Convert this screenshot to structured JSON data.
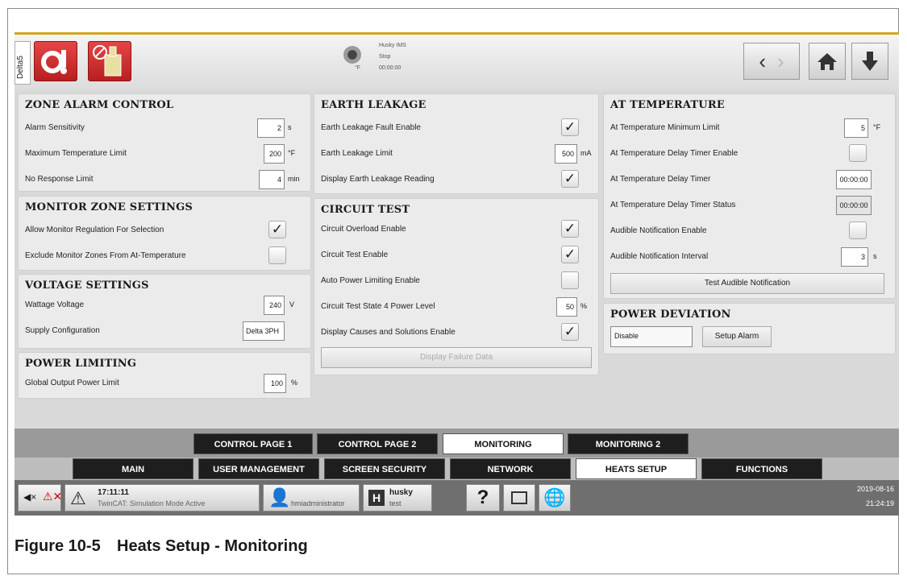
{
  "side_tag": "Delta5",
  "status": {
    "name": "Husky IMS",
    "state": "Stop",
    "time": "00:00:00",
    "unit": "°F"
  },
  "zone_alarm": {
    "title": "ZONE ALARM CONTROL",
    "rows": [
      {
        "label": "Alarm Sensitivity",
        "value": "2",
        "unit": "s"
      },
      {
        "label": "Maximum Temperature Limit",
        "value": "200",
        "unit": "°F"
      },
      {
        "label": "No Response Limit",
        "value": "4",
        "unit": "min"
      }
    ]
  },
  "monitor_zone": {
    "title": "MONITOR ZONE SETTINGS",
    "rows": [
      {
        "label": "Allow Monitor Regulation For Selection",
        "checked": true
      },
      {
        "label": "Exclude Monitor Zones From At-Temperature",
        "checked": false
      }
    ]
  },
  "voltage": {
    "title": "VOLTAGE SETTINGS",
    "wattage_label": "Wattage Voltage",
    "wattage_value": "240",
    "wattage_unit": "V",
    "supply_label": "Supply Configuration",
    "supply_value": "Delta 3PH"
  },
  "power_limiting": {
    "title": "POWER LIMITING",
    "label": "Global Output Power Limit",
    "value": "100",
    "unit": "%"
  },
  "earth_leakage": {
    "title": "EARTH LEAKAGE",
    "fault_label": "Earth Leakage Fault Enable",
    "fault_checked": true,
    "limit_label": "Earth Leakage Limit",
    "limit_value": "500",
    "limit_unit": "mA",
    "display_label": "Display Earth Leakage Reading",
    "display_checked": true
  },
  "circuit_test": {
    "title": "CIRCUIT TEST",
    "overload_label": "Circuit Overload Enable",
    "overload_checked": true,
    "enable_label": "Circuit Test Enable",
    "enable_checked": true,
    "auto_label": "Auto Power Limiting Enable",
    "auto_checked": false,
    "state4_label": "Circuit Test State 4 Power Level",
    "state4_value": "50",
    "state4_unit": "%",
    "causes_label": "Display Causes and Solutions Enable",
    "causes_checked": true,
    "failure_button": "Display Failure Data"
  },
  "at_temperature": {
    "title": "AT TEMPERATURE",
    "min_label": "At Temperature Minimum Limit",
    "min_value": "5",
    "min_unit": "°F",
    "delay_enable_label": "At Temperature Delay Timer Enable",
    "delay_enable_checked": false,
    "delay_label": "At Temperature Delay Timer",
    "delay_value": "00:00:00",
    "delay_status_label": "At Temperature Delay Timer Status",
    "delay_status_value": "00:00:00",
    "audible_label": "Audible Notification Enable",
    "audible_checked": false,
    "interval_label": "Audible Notification Interval",
    "interval_value": "3",
    "interval_unit": "s",
    "test_button": "Test Audible Notification"
  },
  "power_deviation": {
    "title": "POWER DEVIATION",
    "value": "Disable",
    "setup_button": "Setup Alarm"
  },
  "subtabs": [
    "CONTROL PAGE 1",
    "CONTROL PAGE 2",
    "MONITORING",
    "MONITORING 2"
  ],
  "maintabs": [
    "MAIN",
    "USER MANAGEMENT",
    "SCREEN SECURITY",
    "NETWORK",
    "HEATS SETUP",
    "FUNCTIONS"
  ],
  "statusbar": {
    "alarm_time": "17:11:11",
    "alarm_text": "TwinCAT: Simulation Mode Active",
    "user": "hmiadministrator",
    "machine_name": "husky",
    "machine_sub": "test",
    "date": "2019-08-16",
    "clock": "21:24:19"
  },
  "caption": {
    "figure": "Figure 10-5",
    "title": "Heats Setup - Monitoring"
  }
}
